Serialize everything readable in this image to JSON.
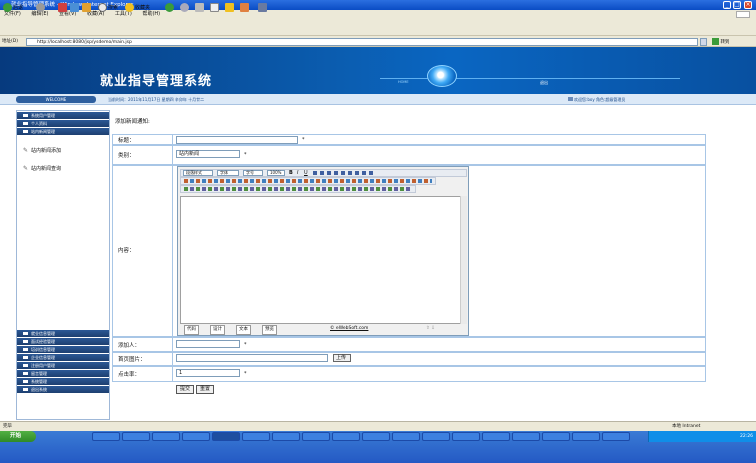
{
  "window": {
    "title": "就业指导管理系统 - Windows Internet Explorer"
  },
  "menu": [
    "文件(F)",
    "编辑(E)",
    "查看(V)",
    "收藏(A)",
    "工具(T)",
    "帮助(H)"
  ],
  "toolbar": {
    "back": "后退",
    "search": "搜索",
    "favorites": "收藏夹"
  },
  "address": {
    "label": "地址(D)",
    "url": "http://localhost:8080/jsp/ysdemo/main.jsp",
    "go": "转到"
  },
  "banner": {
    "title": "就业指导管理系统",
    "tab1": "HOME",
    "tab2": "退出"
  },
  "status": {
    "welcome": "WELCOME",
    "date": "当前时间：2011年11月17日 星期四 辛卯年 十月廿二",
    "user": "欢迎您:boy 角色:超级管理员"
  },
  "sidebar": {
    "top": [
      "系统用户管理",
      "个人资料",
      "站内新闻管理"
    ],
    "sub": [
      "站内新闻添加",
      "站内新闻查询"
    ],
    "bottom": [
      "就业信息管理",
      "面试经验管理",
      "培训信息管理",
      "企业信息管理",
      "注册用户管理",
      "留言管理",
      "系统管理",
      "退出系统"
    ]
  },
  "form": {
    "heading": "添加新闻通知:",
    "title_label": "标题：",
    "category_label": "类别：",
    "category_value": "站内新闻",
    "content_label": "内容：",
    "adder_label": "添加人：",
    "image_label": "首页图片：",
    "upload_button": "上传",
    "clicks_label": "点击率：",
    "clicks_value": "1",
    "required_mark": "*",
    "submit_button": "提交",
    "reset_button": "重置"
  },
  "editor": {
    "style_select": "段落样式",
    "font_select": "字体",
    "size_select": "字号",
    "zoom_select": "100%",
    "bottom_tabs": [
      "代码",
      "设计",
      "文本",
      "预览"
    ],
    "copyright": "© eWebSoft.com"
  },
  "statusbar": {
    "left": "完毕",
    "right": "本地 Intranet"
  },
  "taskbar": {
    "start": "开始",
    "clock": "22:26"
  }
}
